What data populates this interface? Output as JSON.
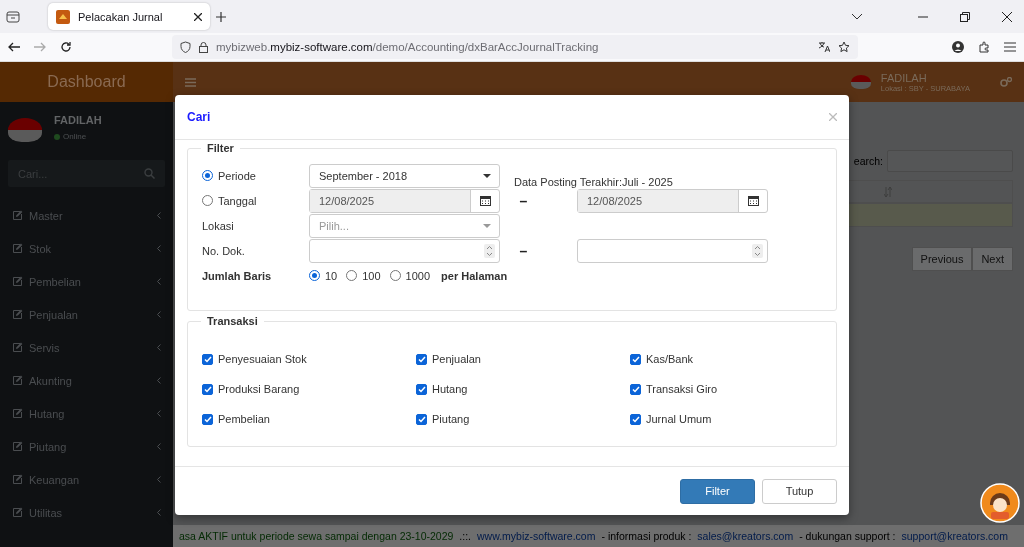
{
  "browser": {
    "tab_title": "Pelacakan Jurnal",
    "url": "mybizweb.**mybiz-software.com**/demo/Accounting/dxBarAccJournalTracking"
  },
  "sidebar": {
    "brand": "Dashboard",
    "user": "FADILAH",
    "status": "Online",
    "search_placeholder": "Cari...",
    "items": [
      {
        "label": "Master"
      },
      {
        "label": "Stok"
      },
      {
        "label": "Pembelian"
      },
      {
        "label": "Penjualan"
      },
      {
        "label": "Servis"
      },
      {
        "label": "Akunting"
      },
      {
        "label": "Hutang"
      },
      {
        "label": "Piutang"
      },
      {
        "label": "Keuangan"
      },
      {
        "label": "Utilitas"
      }
    ]
  },
  "header": {
    "user": "FADILAH",
    "location": "Lokasi : SBY - SURABAYA"
  },
  "content": {
    "search_label": "earch:",
    "pagination": [
      {
        "label": "Previous"
      },
      {
        "label": "Next"
      }
    ]
  },
  "footer": [
    {
      "kind": "notice",
      "text": "asa AKTIF untuk periode sewa sampai dengan 23-10-2029"
    },
    {
      "kind": "text",
      "text": ".::."
    },
    {
      "kind": "link",
      "text": "www.mybiz-software.com"
    },
    {
      "kind": "text",
      "text": "- informasi produk :"
    },
    {
      "kind": "link",
      "text": "sales@kreators.com"
    },
    {
      "kind": "text",
      "text": "- dukungan support :"
    },
    {
      "kind": "link",
      "text": "support@kreators.com"
    }
  ],
  "dialog": {
    "title": "Cari",
    "filter": {
      "legend": "Filter",
      "modes": [
        {
          "label": "Periode",
          "selected": true
        },
        {
          "label": "Tanggal",
          "selected": false
        }
      ],
      "period_value": "September - 2018",
      "posting_info": "Data Posting Terakhir:Juli - 2025",
      "date_from": "12/08/2025",
      "date_separator": "–",
      "date_to": "12/08/2025",
      "location_label": "Lokasi",
      "location_placeholder": "Pilih...",
      "doc_label": "No. Dok.",
      "doc_separator": "–",
      "rows_label": "Jumlah Baris",
      "rows_options": [
        {
          "label": "10",
          "selected": true
        },
        {
          "label": "100",
          "selected": false
        },
        {
          "label": "1000",
          "selected": false
        }
      ],
      "rows_suffix": "per Halaman"
    },
    "transactions": {
      "legend": "Transaksi",
      "items": [
        {
          "label": "Penyesuaian Stok",
          "checked": true
        },
        {
          "label": "Penjualan",
          "checked": true
        },
        {
          "label": "Kas/Bank",
          "checked": true
        },
        {
          "label": "Produksi Barang",
          "checked": true
        },
        {
          "label": "Hutang",
          "checked": true
        },
        {
          "label": "Transaksi Giro",
          "checked": true
        },
        {
          "label": "Pembelian",
          "checked": true
        },
        {
          "label": "Piutang",
          "checked": true
        },
        {
          "label": "Jurnal Umum",
          "checked": true
        }
      ]
    },
    "buttons": [
      {
        "label": "Filter",
        "kind": "primary"
      },
      {
        "label": "Tutup",
        "kind": "default"
      }
    ]
  }
}
